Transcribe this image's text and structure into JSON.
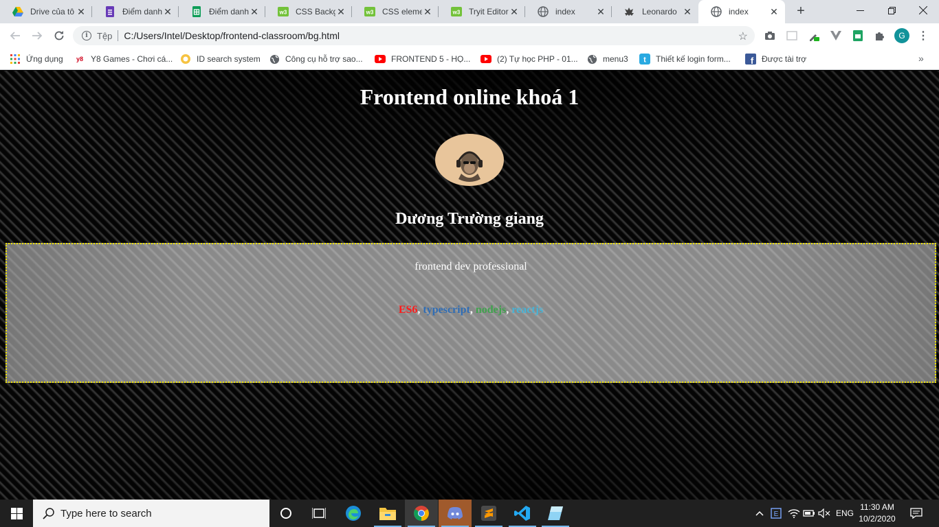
{
  "tabs": [
    {
      "title": "Drive của tô",
      "icon": "google-drive-icon"
    },
    {
      "title": "Điểm danh",
      "icon": "google-forms-icon"
    },
    {
      "title": "Điểm danh",
      "icon": "google-sheets-icon"
    },
    {
      "title": "CSS Backgro",
      "icon": "w3schools-icon"
    },
    {
      "title": "CSS elemen",
      "icon": "w3schools-icon"
    },
    {
      "title": "Tryit Editor",
      "icon": "w3schools-icon"
    },
    {
      "title": "index",
      "icon": "globe-icon"
    },
    {
      "title": "Leonardo",
      "icon": "leonardo-icon"
    },
    {
      "title": "index",
      "icon": "globe-icon",
      "active": true
    }
  ],
  "omnibox": {
    "scheme_label": "Tệp",
    "url": "C:/Users/Intel/Desktop/frontend-classroom/bg.html"
  },
  "profile_initial": "G",
  "bookmarks": [
    {
      "label": "Ứng dụng",
      "icon": "apps-grid-icon"
    },
    {
      "label": "Y8 Games - Chơi cá...",
      "icon": "y8-icon"
    },
    {
      "label": "ID search system",
      "icon": "id-search-icon"
    },
    {
      "label": "Công cụ hỗ trợ sao...",
      "icon": "globe-icon"
    },
    {
      "label": "FRONTEND 5 - HỌ...",
      "icon": "youtube-icon"
    },
    {
      "label": "(2) Tự học PHP - 01...",
      "icon": "youtube-icon"
    },
    {
      "label": "menu3",
      "icon": "globe-icon"
    },
    {
      "label": "Thiết kế login form...",
      "icon": "tumblr-icon"
    },
    {
      "label": "Được tài trợ",
      "icon": "facebook-icon"
    }
  ],
  "page": {
    "title": "Frontend online khoá 1",
    "name": "Dương Trường giang",
    "description": "frontend dev professional",
    "skills": [
      {
        "label": "ES6",
        "color": "#ff1a1a"
      },
      {
        "label": "typescript",
        "color": "#2f6db5"
      },
      {
        "label": "nodejs",
        "color": "#3fa34d"
      },
      {
        "label": "reactjs",
        "color": "#47b3d6"
      }
    ],
    "skill_separator": ", ",
    "card_border_color": "#f0e400"
  },
  "taskbar": {
    "search_placeholder": "Type here to search",
    "language": "ENG",
    "time": "11:30 AM",
    "date": "10/2/2020"
  }
}
